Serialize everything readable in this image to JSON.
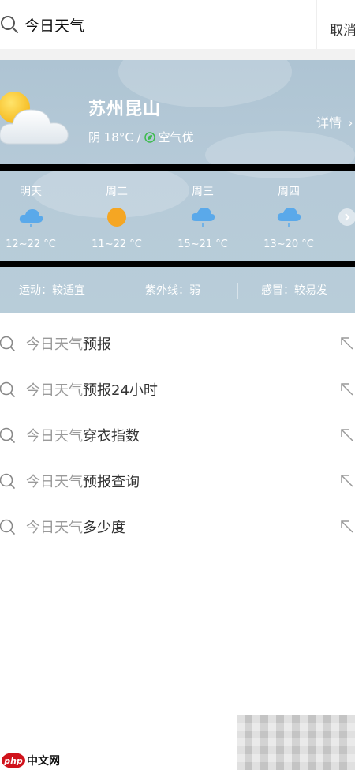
{
  "search": {
    "query": "今日天气",
    "cancel_label": "取消"
  },
  "weather": {
    "city": "苏州昆山",
    "condition": "阴 18°C /",
    "air_quality": "空气优",
    "details_label": "详情",
    "details_chevron": "›",
    "forecast": [
      {
        "day": "明天",
        "temp": "12~22 °C",
        "icon": "cloud-rain-icon"
      },
      {
        "day": "周二",
        "temp": "11~22 °C",
        "icon": "sun-icon"
      },
      {
        "day": "周三",
        "temp": "15~21 °C",
        "icon": "cloud-rain-icon"
      },
      {
        "day": "周四",
        "temp": "13~20 °C",
        "icon": "cloud-rain-icon"
      }
    ],
    "indices": [
      "运动：较适宜",
      "紫外线：弱",
      "感冒：较易发"
    ]
  },
  "suggestions": [
    {
      "prefix": "今日天气",
      "suffix": "预报"
    },
    {
      "prefix": "今日天气",
      "suffix": "预报24小时"
    },
    {
      "prefix": "今日天气",
      "suffix": "穿衣指数"
    },
    {
      "prefix": "今日天气",
      "suffix": "预报查询"
    },
    {
      "prefix": "今日天气",
      "suffix": "多少度"
    }
  ],
  "watermark": {
    "logo": "php",
    "text": "中文网"
  },
  "colors": {
    "card_bg": "#b6cad8",
    "leaf": "#3dbb4e",
    "rain_cloud": "#5aa9ea",
    "sun": "#f5a623"
  }
}
